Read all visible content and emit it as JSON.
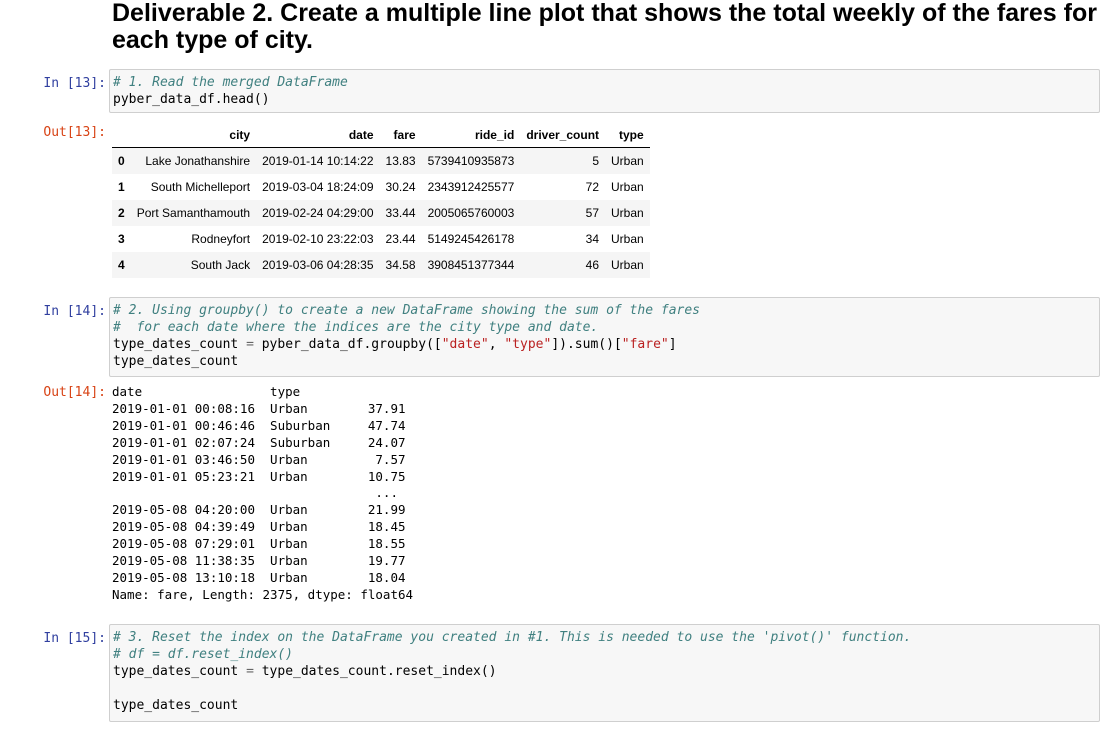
{
  "heading": "Deliverable 2. Create a multiple line plot that shows the total weekly of the fares for each type of city.",
  "cells": {
    "in13": {
      "prompt": "In [13]:",
      "lines": [
        [
          {
            "t": "# 1. Read the merged DataFrame",
            "c": "cm"
          }
        ],
        [
          {
            "t": "pyber_data_df.head()",
            "c": ""
          }
        ]
      ]
    },
    "out13": {
      "prompt": "Out[13]:",
      "columns": [
        "",
        "city",
        "date",
        "fare",
        "ride_id",
        "driver_count",
        "type"
      ],
      "rows": [
        [
          "0",
          "Lake Jonathanshire",
          "2019-01-14 10:14:22",
          "13.83",
          "5739410935873",
          "5",
          "Urban"
        ],
        [
          "1",
          "South Michelleport",
          "2019-03-04 18:24:09",
          "30.24",
          "2343912425577",
          "72",
          "Urban"
        ],
        [
          "2",
          "Port Samanthamouth",
          "2019-02-24 04:29:00",
          "33.44",
          "2005065760003",
          "57",
          "Urban"
        ],
        [
          "3",
          "Rodneyfort",
          "2019-02-10 23:22:03",
          "23.44",
          "5149245426178",
          "34",
          "Urban"
        ],
        [
          "4",
          "South Jack",
          "2019-03-06 04:28:35",
          "34.58",
          "3908451377344",
          "46",
          "Urban"
        ]
      ]
    },
    "in14": {
      "prompt": "In [14]:",
      "lines": [
        [
          {
            "t": "# 2. Using groupby() to create a new DataFrame showing the sum of the fares",
            "c": "cm"
          }
        ],
        [
          {
            "t": "#  for each date where the indices are the city type and date.",
            "c": "cm"
          }
        ],
        [
          {
            "t": "type_dates_count ",
            "c": ""
          },
          {
            "t": "=",
            "c": "op"
          },
          {
            "t": " pyber_data_df.groupby([",
            "c": ""
          },
          {
            "t": "\"date\"",
            "c": "st"
          },
          {
            "t": ", ",
            "c": ""
          },
          {
            "t": "\"type\"",
            "c": "st"
          },
          {
            "t": "]).sum()[",
            "c": ""
          },
          {
            "t": "\"fare\"",
            "c": "st"
          },
          {
            "t": "]",
            "c": ""
          }
        ],
        [
          {
            "t": "type_dates_count",
            "c": ""
          }
        ]
      ]
    },
    "out14": {
      "prompt": "Out[14]:",
      "lines": [
        "date                 type",
        "2019-01-01 00:08:16  Urban        37.91",
        "2019-01-01 00:46:46  Suburban     47.74",
        "2019-01-01 02:07:24  Suburban     24.07",
        "2019-01-01 03:46:50  Urban         7.57",
        "2019-01-01 05:23:21  Urban        10.75",
        "                                   ...",
        "2019-05-08 04:20:00  Urban        21.99",
        "2019-05-08 04:39:49  Urban        18.45",
        "2019-05-08 07:29:01  Urban        18.55",
        "2019-05-08 11:38:35  Urban        19.77",
        "2019-05-08 13:10:18  Urban        18.04",
        "Name: fare, Length: 2375, dtype: float64"
      ]
    },
    "in15": {
      "prompt": "In [15]:",
      "lines": [
        [
          {
            "t": "# 3. Reset the index on the DataFrame you created in #1. This is needed to use the 'pivot()' function.",
            "c": "cm"
          }
        ],
        [
          {
            "t": "# df = df.reset_index()",
            "c": "cm"
          }
        ],
        [
          {
            "t": "type_dates_count ",
            "c": ""
          },
          {
            "t": "=",
            "c": "op"
          },
          {
            "t": " type_dates_count.reset_index()",
            "c": ""
          }
        ],
        [
          {
            "t": "",
            "c": ""
          }
        ],
        [
          {
            "t": "type_dates_count",
            "c": ""
          }
        ]
      ]
    }
  }
}
